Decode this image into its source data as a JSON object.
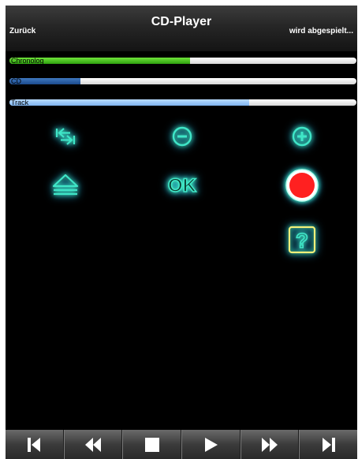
{
  "header": {
    "title": "CD-Player",
    "back_label": "Zurück",
    "status": "wird abgespielt..."
  },
  "progress": [
    {
      "label": "Chronolog",
      "fraction": 0.52
    },
    {
      "label": "CD",
      "fraction": 0.205
    },
    {
      "label": "Track",
      "fraction": 0.69
    }
  ],
  "controls": [
    {
      "icon": "skip-back-icon"
    },
    {
      "icon": "minus-icon"
    },
    {
      "icon": "plus-icon"
    },
    {
      "icon": "eject-icon"
    },
    {
      "icon": "ok-icon",
      "text": "OK"
    },
    {
      "icon": "record-icon"
    },
    {
      "icon": "help-icon",
      "text": "?"
    }
  ],
  "transport": [
    {
      "icon": "previous-track-icon"
    },
    {
      "icon": "rewind-icon"
    },
    {
      "icon": "stop-icon"
    },
    {
      "icon": "play-icon"
    },
    {
      "icon": "fast-forward-icon"
    },
    {
      "icon": "next-track-icon"
    }
  ],
  "colors": {
    "icon_glow": "#3fe6c8",
    "record": "#ff2020",
    "chronolog_fill": "#3dbb1c",
    "cd_fill": "#275c9e",
    "track_fill": "#9cc8f6"
  }
}
